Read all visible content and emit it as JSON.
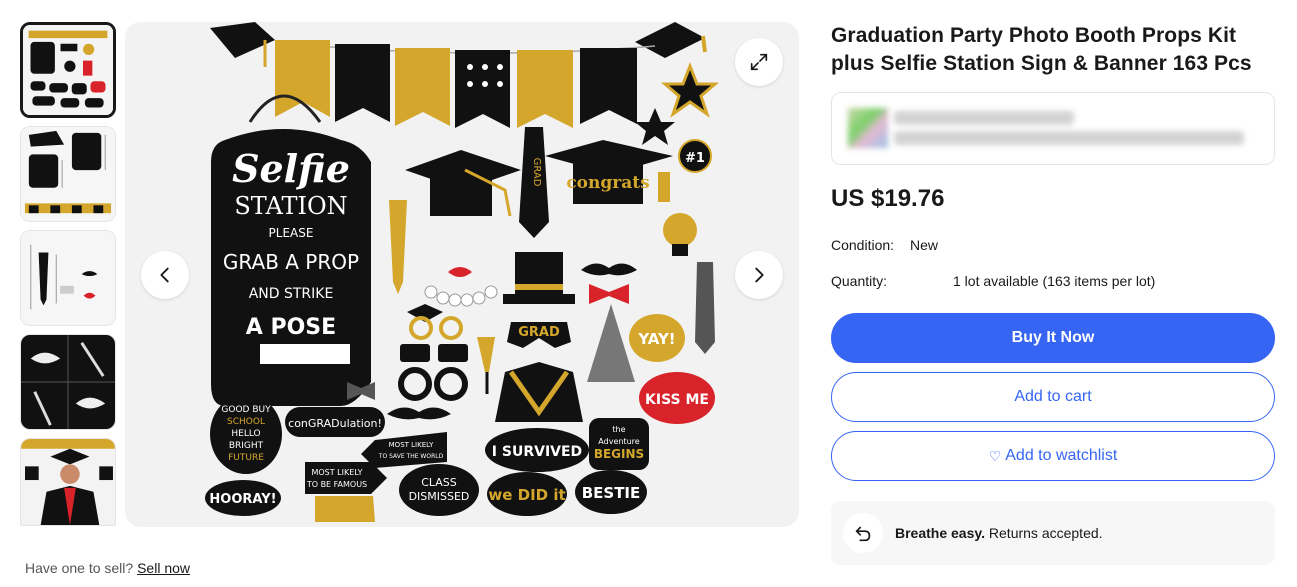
{
  "product": {
    "title": "Graduation Party Photo Booth Props Kit plus Selfie Station Sign & Banner 163 Pcs",
    "price": "US $19.76",
    "condition_label": "Condition:",
    "condition_value": "New",
    "quantity_label": "Quantity:",
    "quantity_value": "1 lot available (163 items per lot)"
  },
  "buttons": {
    "buy_now": "Buy It Now",
    "add_to_cart": "Add to cart",
    "add_to_watchlist": "Add to watchlist"
  },
  "returns": {
    "bold": "Breathe easy.",
    "text": " Returns accepted."
  },
  "sell": {
    "prompt": "Have one to sell?",
    "link": "Sell now"
  },
  "image_text": {
    "sign_line1": "Selfie",
    "sign_line2": "STATION",
    "sign_line3": "PLEASE",
    "sign_line4": "GRAB A PROP",
    "sign_line5": "AND STRIKE",
    "sign_line6": "A POSE",
    "sign_hash": "#",
    "congrats": "congrats",
    "grad_tie": "GRAD",
    "grad_mask": "GRAD",
    "number_one": "#1",
    "yay": "YAY!",
    "kiss_me": "KISS ME",
    "good_buy": [
      "GOOD BUY",
      "SCHOOL",
      "HELLO",
      "BRIGHT",
      "FUTURE"
    ],
    "congradulation": "conGRADulation!",
    "most_likely_world": [
      "MOST LIKELY",
      "TO SAVE THE WORLD"
    ],
    "most_likely_famous": [
      "MOST LIKELY",
      "TO BE FAMOUS"
    ],
    "i_survived": "I SURVIVED",
    "adventure": [
      "the",
      "Adventure",
      "BEGINS"
    ],
    "hooray": "HOORAY!",
    "class_dismissed": [
      "CLASS",
      "DISMISSED"
    ],
    "we_did_it": "we DID it",
    "bestie": "BESTIE"
  },
  "colors": {
    "accent_blue": "#3665f3",
    "gold": "#d4a72c",
    "black": "#111111",
    "red": "#d8232a"
  },
  "icons": [
    "expand-icon",
    "chevron-left-icon",
    "chevron-right-icon",
    "heart-icon",
    "return-arrow-icon"
  ]
}
